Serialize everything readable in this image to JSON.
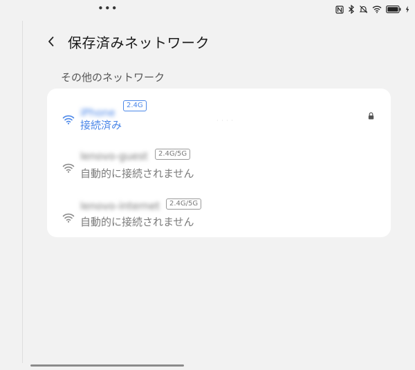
{
  "status_bar": {
    "more": "•••",
    "icons": [
      "nfc-icon",
      "bluetooth-icon",
      "mute-icon",
      "wifi-icon",
      "battery-icon",
      "charging-icon"
    ]
  },
  "header": {
    "back_icon": "chevron-left-icon",
    "title": "保存済みネットワーク"
  },
  "section": {
    "title": "その他のネットワーク"
  },
  "networks": [
    {
      "ssid": "iPhone",
      "band": "2.4G",
      "status": "接続済み",
      "state": "connected",
      "locked": true,
      "icon": "wifi-icon"
    },
    {
      "ssid": "lenovo-guest",
      "band": "2.4G/5G",
      "status": "自動的に接続されません",
      "state": "saved",
      "locked": false,
      "icon": "wifi-icon"
    },
    {
      "ssid": "lenovo-internet",
      "band": "2.4G/5G",
      "status": "自動的に接続されません",
      "state": "saved",
      "locked": false,
      "icon": "wifi-icon"
    }
  ],
  "colors": {
    "accent": "#4a86e8",
    "background": "#f2f2f2",
    "card": "#ffffff",
    "muted_text": "#7a7a7a"
  }
}
